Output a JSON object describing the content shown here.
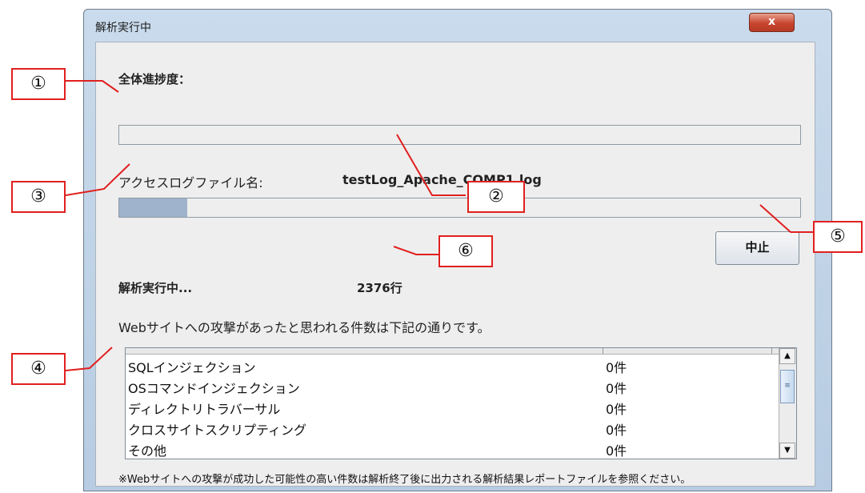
{
  "window": {
    "title": "解析実行中",
    "close_label": "x"
  },
  "overall": {
    "label": "全体進捗度：",
    "progress": 0
  },
  "file": {
    "label": "アクセスログファイル名:",
    "name": "testLog_Apache_COMP1.log",
    "progress": 0.1
  },
  "stop_button": {
    "label": "中止"
  },
  "status": {
    "label": "解析実行中...",
    "lines": "2376行"
  },
  "description": "Webサイトへの攻撃があったと思われる件数は下記の通りです。",
  "attacks": [
    {
      "name": "SQLインジェクション",
      "count": "0件"
    },
    {
      "name": "OSコマンドインジェクション",
      "count": "0件"
    },
    {
      "name": "ディレクトリトラバーサル",
      "count": "0件"
    },
    {
      "name": "クロスサイトスクリプティング",
      "count": "0件"
    },
    {
      "name": "その他",
      "count": "0件"
    }
  ],
  "footnote": "※Webサイトへの攻撃が成功した可能性の高い件数は解析終了後に出力される解析結果レポートファイルを参照ください。",
  "callouts": [
    "①",
    "②",
    "③",
    "④",
    "⑤",
    "⑥"
  ],
  "colors": {
    "accent": "#e0201f",
    "progress_fill": "#9fb3cc"
  }
}
